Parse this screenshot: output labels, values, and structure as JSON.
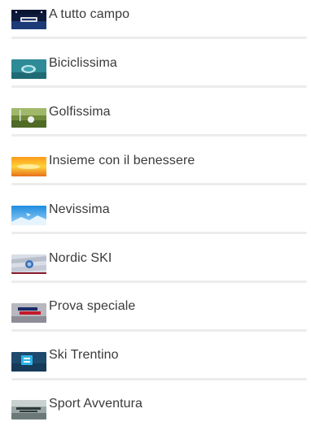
{
  "programs": [
    {
      "label": "A tutto campo",
      "thumb": "a-tutto-campo-thumbnail"
    },
    {
      "label": "Biciclissima",
      "thumb": "biciclissima-thumbnail"
    },
    {
      "label": "Golfissima",
      "thumb": "golfissima-thumbnail"
    },
    {
      "label": "Insieme con il benessere",
      "thumb": "insieme-con-il-benessere-thumbnail"
    },
    {
      "label": "Nevissima",
      "thumb": "nevissima-thumbnail"
    },
    {
      "label": "Nordic SKI",
      "thumb": "nordic-ski-thumbnail"
    },
    {
      "label": "Prova speciale",
      "thumb": "prova-speciale-thumbnail"
    },
    {
      "label": "Ski Trentino",
      "thumb": "ski-trentino-thumbnail"
    },
    {
      "label": "Sport Avventura",
      "thumb": "sport-avventura-thumbnail"
    }
  ],
  "colors": {
    "text": "#3a3a3a",
    "divider": "#ececec"
  }
}
